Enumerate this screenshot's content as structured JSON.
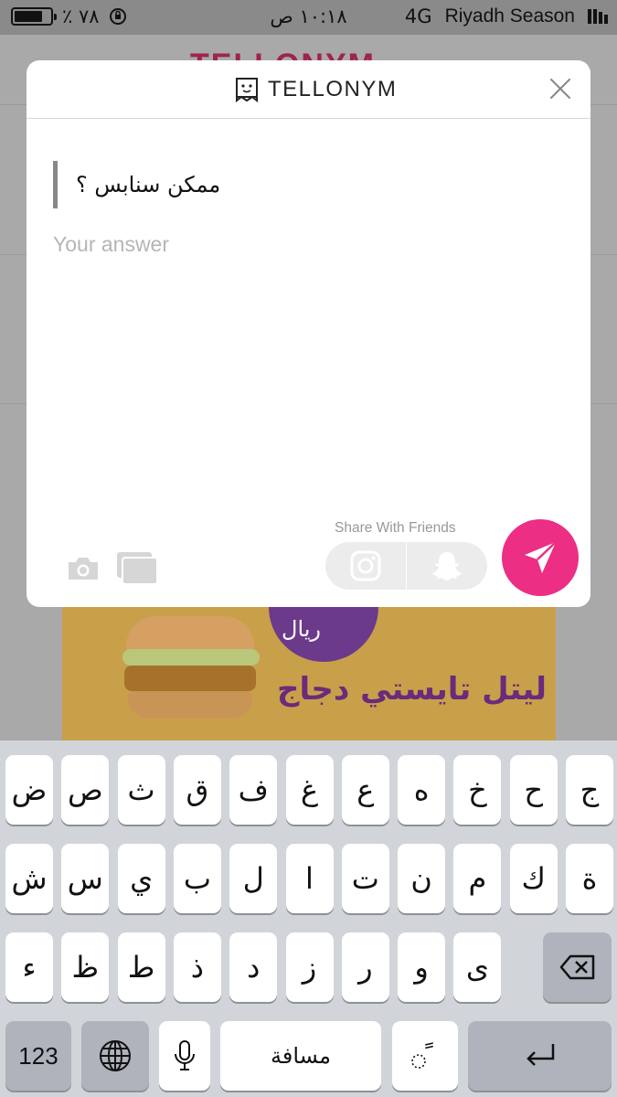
{
  "status_bar": {
    "battery_text": "٪ ٧٨",
    "time": "١٠:١٨ ص",
    "network": "4G",
    "carrier": "Riyadh Season"
  },
  "background": {
    "logo_text": "TELLONYM",
    "ad_price": "ريال",
    "ad_headline": "ليتل تايستي دجاج"
  },
  "modal": {
    "title": "TELLONYM",
    "question": "ممكن سنابس ؟",
    "answer_placeholder": "Your answer",
    "share_label": "Share With Friends",
    "icons": {
      "logo": "tellonym-logo-icon",
      "close": "close-icon",
      "camera": "camera-icon",
      "gallery": "gallery-icon",
      "instagram": "instagram-icon",
      "snapchat": "snapchat-icon",
      "send": "send-icon"
    },
    "accent_color": "#ec2e84"
  },
  "keyboard": {
    "row1": [
      "ض",
      "ص",
      "ث",
      "ق",
      "ف",
      "غ",
      "ع",
      "ه",
      "خ",
      "ح",
      "ج"
    ],
    "row2": [
      "ش",
      "س",
      "ي",
      "ب",
      "ل",
      "ا",
      "ت",
      "ن",
      "م",
      "ك",
      "ة"
    ],
    "row3": [
      "ء",
      "ظ",
      "ط",
      "ذ",
      "د",
      "ز",
      "ر",
      "و",
      "ى"
    ],
    "numbers_label": "123",
    "space_label": "مسافة",
    "diacritic_label": "ً"
  }
}
